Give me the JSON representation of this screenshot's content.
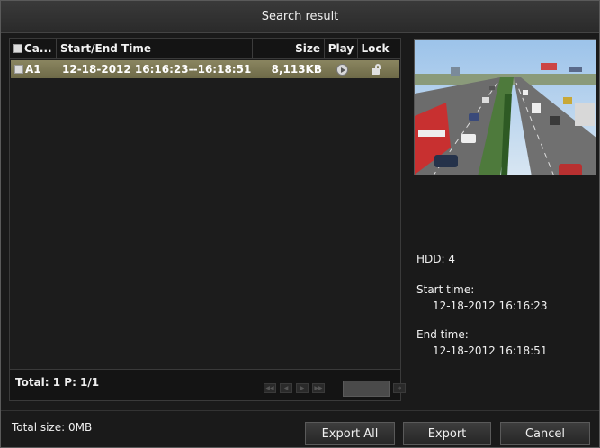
{
  "window": {
    "title": "Search result"
  },
  "table": {
    "headers": {
      "camera": "Ca...",
      "time": "Start/End Time",
      "size": "Size",
      "play": "Play",
      "lock": "Lock"
    },
    "rows": [
      {
        "camera": "A1",
        "time": "12-18-2012 16:16:23--16:18:51",
        "size": "8,113KB",
        "play_icon": "play-circle-icon",
        "lock_icon": "unlock-icon",
        "selected": true
      }
    ],
    "selected_row_color": "#7c7854"
  },
  "pager": {
    "text": "Total: 1  P: 1/1"
  },
  "details": {
    "hdd": "HDD: 4",
    "start_label": "Start time:",
    "start_value": "12-18-2012 16:16:23",
    "end_label": "End time:",
    "end_value": "12-18-2012 16:18:51"
  },
  "footer": {
    "total_size": "Total size: 0MB",
    "export_all": "Export All",
    "export": "Export",
    "cancel": "Cancel"
  }
}
